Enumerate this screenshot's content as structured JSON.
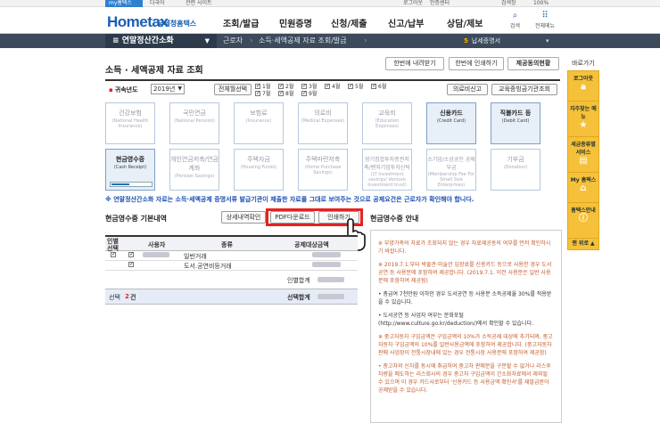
{
  "util": {
    "mytax": "my홈택스",
    "items": [
      "다국어",
      "관련 사이트",
      "로그아웃",
      "인증센터",
      "검색창",
      "100%"
    ]
  },
  "header": {
    "logo_main": "Hometax",
    "logo_kr": "국세청홈택스",
    "menus": [
      "조회/발급",
      "민원증명",
      "신청/제출",
      "신고/납부",
      "상담/제보"
    ],
    "search_label": "검색",
    "allmenu_label": "전체메뉴"
  },
  "nav": {
    "menu_title": "연말정산간소화",
    "crumbs": [
      "근로자",
      "소득·세액공제 자료 조회/발급"
    ],
    "due_num": "5",
    "due_label": "납세증명서"
  },
  "page": {
    "title": "소득 · 세액공제 자료 조회",
    "buttons": [
      "한번에 내려받기",
      "한번에 인쇄하기",
      "제공동의현황"
    ]
  },
  "filter": {
    "year_label": "귀속년도",
    "year_value": "2019년",
    "select_all": "전체월선택",
    "months_row1": [
      "1월",
      "2월",
      "3월",
      "4월",
      "5월",
      "6월"
    ],
    "months_row2": [
      "7월",
      "8월",
      "9월"
    ],
    "btn_medical": "의료비신고",
    "btn_tuition": "교육증빙금기관조회"
  },
  "categories": [
    {
      "t1": "건강보험",
      "t2": "(National Health Insurance)",
      "active": false
    },
    {
      "t1": "국민연금",
      "t2": "(National Pension)",
      "active": false
    },
    {
      "t1": "보험료",
      "t2": "(Insurance)",
      "active": false
    },
    {
      "t1": "의료비",
      "t2": "(Medical Expenses)",
      "active": false
    },
    {
      "t1": "교육비",
      "t2": "(Education Expenses)",
      "active": false
    },
    {
      "t1": "신용카드",
      "t2": "(Credit Card)",
      "active": true
    },
    {
      "t1": "직불카드 등",
      "t2": "(Debit Card)",
      "active": true
    },
    {
      "t1": "현금영수증",
      "t2": "(Cash Receipt)",
      "active": true
    },
    {
      "t1": "개인연금저축/연금계좌",
      "t2": "(Pension Savings)",
      "active": false
    },
    {
      "t1": "주택자금",
      "t2": "(Housing Funds)",
      "active": false
    },
    {
      "t1": "주택마련저축",
      "t2": "(Home Purchase Savings)",
      "active": false
    },
    {
      "t1": "장기집합투자증권저축/벤처기업투자신탁",
      "t2": "(LT investment savings/ Venture Investment trust)",
      "active": false
    },
    {
      "t1": "소기업/소상공인 공제부금",
      "t2": "(Membership Fee For Small Size Enterprises)",
      "active": false
    },
    {
      "t1": "기부금",
      "t2": "(Donation)",
      "active": false
    }
  ],
  "notice": "※ 연말정산간소화 자료는 소득·세액공제 증명서류 발급기관이 제출한 자료를 그대로 보여주는 것으로 공제요건은 근로자가 확인해야 합니다.",
  "receipts": {
    "title": "현금영수증 기본내역",
    "btn_detail": "상세내역확인",
    "btn_pdf": "PDF다운로드",
    "btn_print": "인쇄하기",
    "col_select": "인별선택",
    "col_user": "사용자",
    "col_type": "종류",
    "col_amount": "공제대상금액",
    "rows": [
      {
        "type": "일반거래"
      },
      {
        "type": "도서.공연비등거래"
      }
    ],
    "subtotal_label": "인별합계",
    "total_select": "선택",
    "total_count": "2",
    "total_count_unit": "건",
    "total_label": "선택합계"
  },
  "guide": {
    "title": "현금영수증 안내",
    "paragraphs": [
      "※ 부양가족의 자료가 조회되지 않는 경우 자료제공동의 여부를 먼저 확인하시기 바랍니다.",
      "※ 2019.7.1.부터 박물관·미술관 입장료를 신용카드 등으로 사용한 경우 도서공연 등 사용분에 포함하여 제공합니다. (2019.7.1. 이전 사용분은 일반 사용분에 포함하여 제공됨)",
      "• 총급여 7천만원 이하인 경우 도서공연 등 사용분 소득공제율 30%를 적용받을 수 있습니다.",
      "• 도서공연 등 사업자 여부는 문화포털 (http://www.culture.go.kr/deduction/)에서 확인할 수 있습니다.",
      "※ 중고자동차 구입금액은 구입금액의 10%가 소득공제 대상에 추가되며, 중고자동차 구입금액의 10%를 일반사용금액에 포함하여 제공합니다. (중고자동차판매 사업장이 전통시장내에 있는 경우 전통시장 사용분에 포함하여 제공함)",
      "• 중고차와 신차를 동시에 취급하여 중고차 판매분을 구분할 수 없거나 리스후 차량을 매도하는 리스회사의 경우 중고차 구입금액이 간소화자료에서 제외될 수 있으며 이 경우 카드사로부터 '신용카드 등 사용금액 확인서'를 재발급받아 공제받을 수 있습니다."
    ]
  },
  "sidebar": {
    "caption": "바로가기",
    "items": [
      "로그아웃",
      "자주찾는 메뉴",
      "세금종류별 서비스",
      "My 홈택스",
      "홈택스안내"
    ],
    "up": "맨 위로"
  },
  "colors": {
    "nav_dark": "#3c4a5c",
    "brand_blue": "#1a5fb4",
    "highlight_red": "#e32222",
    "side_yellow": "#f6c13a"
  }
}
